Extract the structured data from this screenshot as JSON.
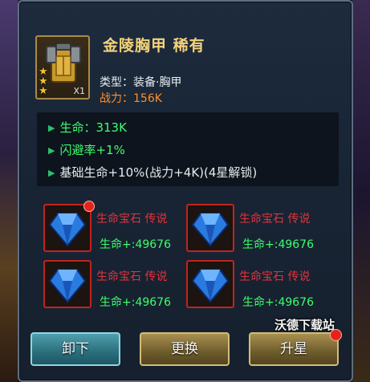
{
  "item": {
    "name": "金陵胸甲 稀有",
    "quantity": "X1",
    "stars": 3,
    "type_label": "类型：",
    "type_value": "装备·胸甲",
    "power_label": "战力：",
    "power_value": "156K"
  },
  "stats": [
    {
      "label": "生命：313K"
    },
    {
      "label": "闪避率",
      "value": "+1%"
    },
    {
      "label": "基础生命+10%(战力+4K)(4星解锁)"
    }
  ],
  "gems": [
    {
      "name": "生命宝石 传说",
      "value": "生命+:49676"
    },
    {
      "name": "生命宝石 传说",
      "value": "生命+:49676"
    },
    {
      "name": "生命宝石 传说",
      "value": "生命+:49676"
    },
    {
      "name": "生命宝石 传说",
      "value": "生命+:49676"
    }
  ],
  "buttons": {
    "unequip": "卸下",
    "replace": "更换",
    "upgrade_star": "升星"
  },
  "watermark": "沃德下载站",
  "colors": {
    "title": "#f4d27a",
    "power": "#ff8f2a",
    "stat_green": "#3dff6e",
    "gem_name": "#e0343c",
    "gem_border": "#c0241e"
  }
}
